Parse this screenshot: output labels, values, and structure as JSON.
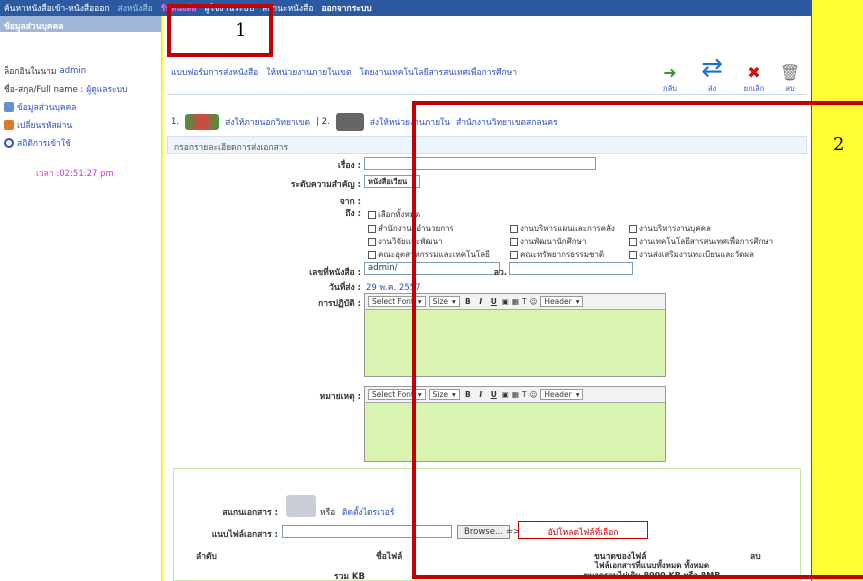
{
  "topnav": {
    "items": [
      "ค้นหาหนังสือเข้า-หนังสือออก",
      "ส่งหนังสือ",
      "รับหนังสือ",
      "ผู้ใช้งานระบบ",
      "สถานะหนังสือ",
      "ออกจากระบบ"
    ]
  },
  "left": {
    "header": "ข้อมูลส่วนบุคคล",
    "login_label": "ล็อกอินในนาม",
    "login_user": "admin",
    "fullname_label": "ชื่อ-สกุล/Full name :",
    "fullname_value": "ผู้ดูแลระบบ",
    "menu": [
      "ข้อมูลส่วนบุคคล",
      "เปลี่ยนรหัสผ่าน",
      "สถิติการเข้าใช้"
    ],
    "time_label": "เวลา",
    "time_value": ":02:51:27 pm"
  },
  "main": {
    "tabs": [
      "แบบฟอร์มการส่งหนังสือ",
      "ให้หน่วยงานภายในเขต",
      "โดยงานเทคโนโลยีสารสนเทศเพื่อการศึกษา"
    ],
    "actions": [
      {
        "icon": "back-arrow-icon",
        "label": "กลับ"
      },
      {
        "icon": "send-icon",
        "label": "ส่ง"
      },
      {
        "icon": "cancel-icon",
        "label": "ยกเลิก"
      },
      {
        "icon": "trash-icon",
        "label": "ลบ"
      }
    ],
    "step1_num": "1.",
    "step1_label": "ส่งให้ภายนอกวิทยาเขต",
    "step2_num": "| 2.",
    "step2_label": "ส่งให้หน่วยงานภายใน",
    "step2_org": "สำนักงานวิทยาเขตสกลนคร",
    "section_title": "กรอกรายละเอียดการส่งเอกสาร",
    "fields": {
      "subject_label": "เรื่อง :",
      "priority_label": "ระดับความสำคัญ :",
      "priority_value": "หนังสือเวียน",
      "from_label": "จาก :",
      "to_label": "ถึง :",
      "docno_label": "เลขที่หนังสือ :",
      "docno_value": "admin/",
      "date_label": "วันที่ส่ง :",
      "date_value": "29 พ.ค. 2557",
      "dated_label": "ลว.",
      "action_label": "การปฏิบัติ :",
      "note_label": "หมายเหตุ :"
    },
    "checkboxes": [
      "เลือกทั้งหมด",
      "สำนักงานผู้อำนวยการ",
      "งานบริหารแผนและการคลัง",
      "งานบริหารงานบุคคล",
      "งานวิจัยและพัฒนา",
      "งานพัฒนานักศึกษา",
      "งานเทคโนโลยีสารสนเทศเพื่อการศึกษา",
      "คณะอุตสาหกรรมและเทคโนโลยี",
      "คณะทรัพยากรธรรมชาติ",
      "งานส่งเสริมงานทะเบียนและวัดผล"
    ],
    "editor": {
      "font": "Select Font",
      "size": "Size",
      "header": "Header",
      "bold": "B",
      "italic": "I",
      "underline": "U"
    },
    "upload": {
      "scan_label": "สแกนเอกสาร :",
      "scan_or": "หรือ",
      "scan_link": "ติดตั้งไดรเวอร์",
      "attach_label": "แนบไฟล์เอกสาร :",
      "browse": "Browse...",
      "arrow": "=>",
      "upload_btn": "อัปโหลดไฟล์ที่เลือก",
      "col_order": "ลำดับ",
      "col_name": "ชื่อไฟล์",
      "col_size": "ขนาดของไฟล์",
      "col_del": "ลบ",
      "total_label": "รวม",
      "total_unit": "KB",
      "note_line1": "ไฟล์เอกสารที่แนบทั้งหมด ทั้งหมด",
      "note_line2": "ขนาดรวมไม่เกิน 8000 KB หรือ 8MB"
    }
  },
  "annotations": [
    "1",
    "2"
  ]
}
